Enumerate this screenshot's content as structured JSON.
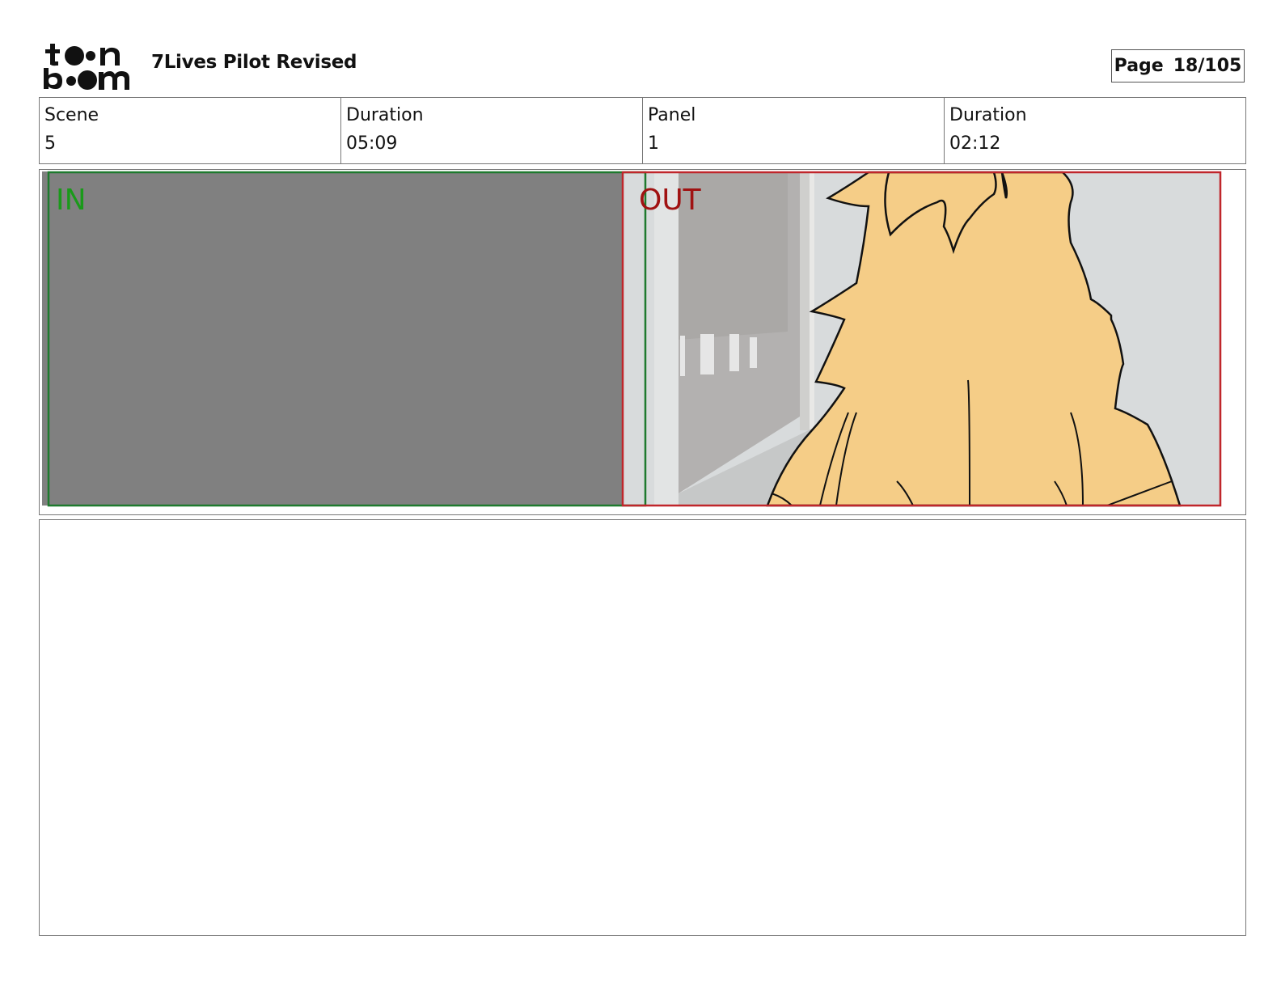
{
  "header": {
    "logo_text": "toon boom",
    "project_title": "7Lives Pilot Revised",
    "page_label": "Page",
    "page_number": "18/105"
  },
  "info": [
    {
      "label": "Scene",
      "value": "5"
    },
    {
      "label": "Duration",
      "value": "05:09"
    },
    {
      "label": "Panel",
      "value": "1"
    },
    {
      "label": "Duration",
      "value": "02:12"
    }
  ],
  "panel_image": {
    "in_label": "IN",
    "out_label": "OUT",
    "colors": {
      "in_frame": "#1e7a2e",
      "out_frame": "#c0262b",
      "gray_fill": "#808080",
      "hair": "#f5cd87",
      "background": "#d8dbdc"
    }
  },
  "notes": {}
}
